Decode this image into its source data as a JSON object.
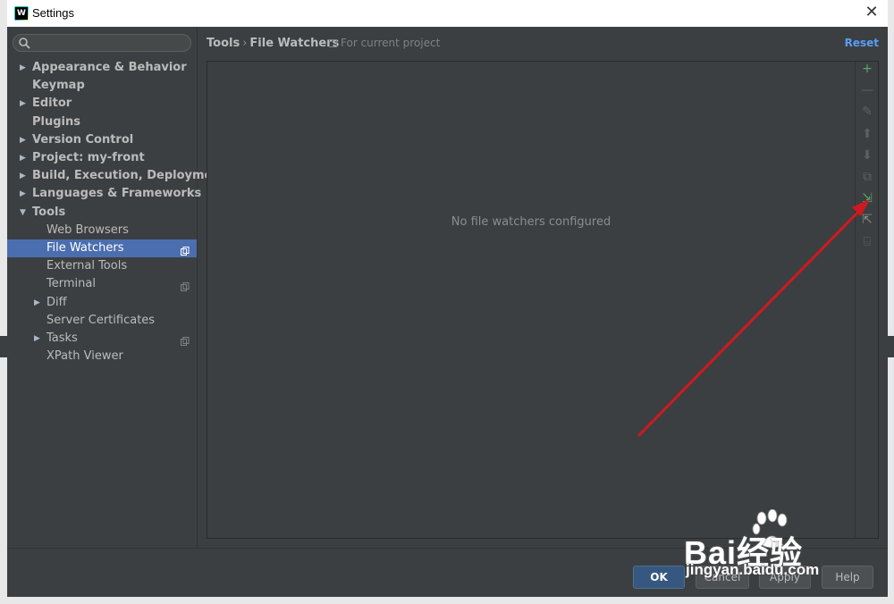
{
  "window": {
    "title": "Settings",
    "close_glyph": "✕"
  },
  "search": {
    "placeholder": "",
    "icon": "search-icon"
  },
  "tree": [
    {
      "label": "Appearance & Behavior",
      "bold": true,
      "expandable": true,
      "expanded": false,
      "level": 0
    },
    {
      "label": "Keymap",
      "bold": true,
      "expandable": false,
      "level": 0
    },
    {
      "label": "Editor",
      "bold": true,
      "expandable": true,
      "expanded": false,
      "level": 0
    },
    {
      "label": "Plugins",
      "bold": true,
      "expandable": false,
      "level": 0
    },
    {
      "label": "Version Control",
      "bold": true,
      "expandable": true,
      "expanded": false,
      "level": 0
    },
    {
      "label": "Project: my-front",
      "bold": true,
      "expandable": true,
      "expanded": false,
      "level": 0
    },
    {
      "label": "Build, Execution, Deployment",
      "bold": true,
      "expandable": true,
      "expanded": false,
      "level": 0
    },
    {
      "label": "Languages & Frameworks",
      "bold": true,
      "expandable": true,
      "expanded": false,
      "level": 0
    },
    {
      "label": "Tools",
      "bold": true,
      "expandable": true,
      "expanded": true,
      "level": 0
    },
    {
      "label": "Web Browsers",
      "bold": false,
      "expandable": false,
      "level": 1
    },
    {
      "label": "File Watchers",
      "bold": false,
      "expandable": false,
      "level": 1,
      "selected": true,
      "project": true
    },
    {
      "label": "External Tools",
      "bold": false,
      "expandable": false,
      "level": 1
    },
    {
      "label": "Terminal",
      "bold": false,
      "expandable": false,
      "level": 1,
      "project": true
    },
    {
      "label": "Diff",
      "bold": false,
      "expandable": true,
      "expanded": false,
      "level": 1
    },
    {
      "label": "Server Certificates",
      "bold": false,
      "expandable": false,
      "level": 1
    },
    {
      "label": "Tasks",
      "bold": false,
      "expandable": true,
      "expanded": false,
      "level": 1,
      "project": true
    },
    {
      "label": "XPath Viewer",
      "bold": false,
      "expandable": false,
      "level": 1
    }
  ],
  "header": {
    "crumb_root": "Tools",
    "crumb_sep": "›",
    "crumb_leaf": "File Watchers",
    "scope": "For current project",
    "reset": "Reset"
  },
  "panel": {
    "empty_text": "No file watchers configured"
  },
  "toolbar": [
    {
      "icon": "add-icon",
      "glyph": "+",
      "color": "#59a869",
      "enabled": true
    },
    {
      "icon": "remove-icon",
      "glyph": "—",
      "color": "#5e6060",
      "enabled": false
    },
    {
      "icon": "edit-icon",
      "glyph": "✎",
      "color": "#5e6060",
      "enabled": false
    },
    {
      "icon": "move-up-icon",
      "glyph": "⬆",
      "color": "#5e6060",
      "enabled": false
    },
    {
      "icon": "move-down-icon",
      "glyph": "⬇",
      "color": "#5e6060",
      "enabled": false
    },
    {
      "icon": "copy-icon",
      "glyph": "⧉",
      "color": "#5e6060",
      "enabled": false
    },
    {
      "icon": "import-icon",
      "glyph": "⇲",
      "color": "#59a869",
      "enabled": true
    },
    {
      "icon": "export-icon",
      "glyph": "⇱",
      "color": "#8c8c8c",
      "enabled": true
    },
    {
      "icon": "filter-icon",
      "glyph": "⌸",
      "color": "#5e6060",
      "enabled": false
    }
  ],
  "buttons": {
    "ok": "OK",
    "cancel": "Cancel",
    "apply": "Apply",
    "help": "Help"
  },
  "watermark": {
    "brand": "Bai经验",
    "url": "jingyan.baidu.com"
  },
  "colors": {
    "accent": "#4b6eaf",
    "link": "#589df6",
    "arrow": "#d0191f"
  }
}
